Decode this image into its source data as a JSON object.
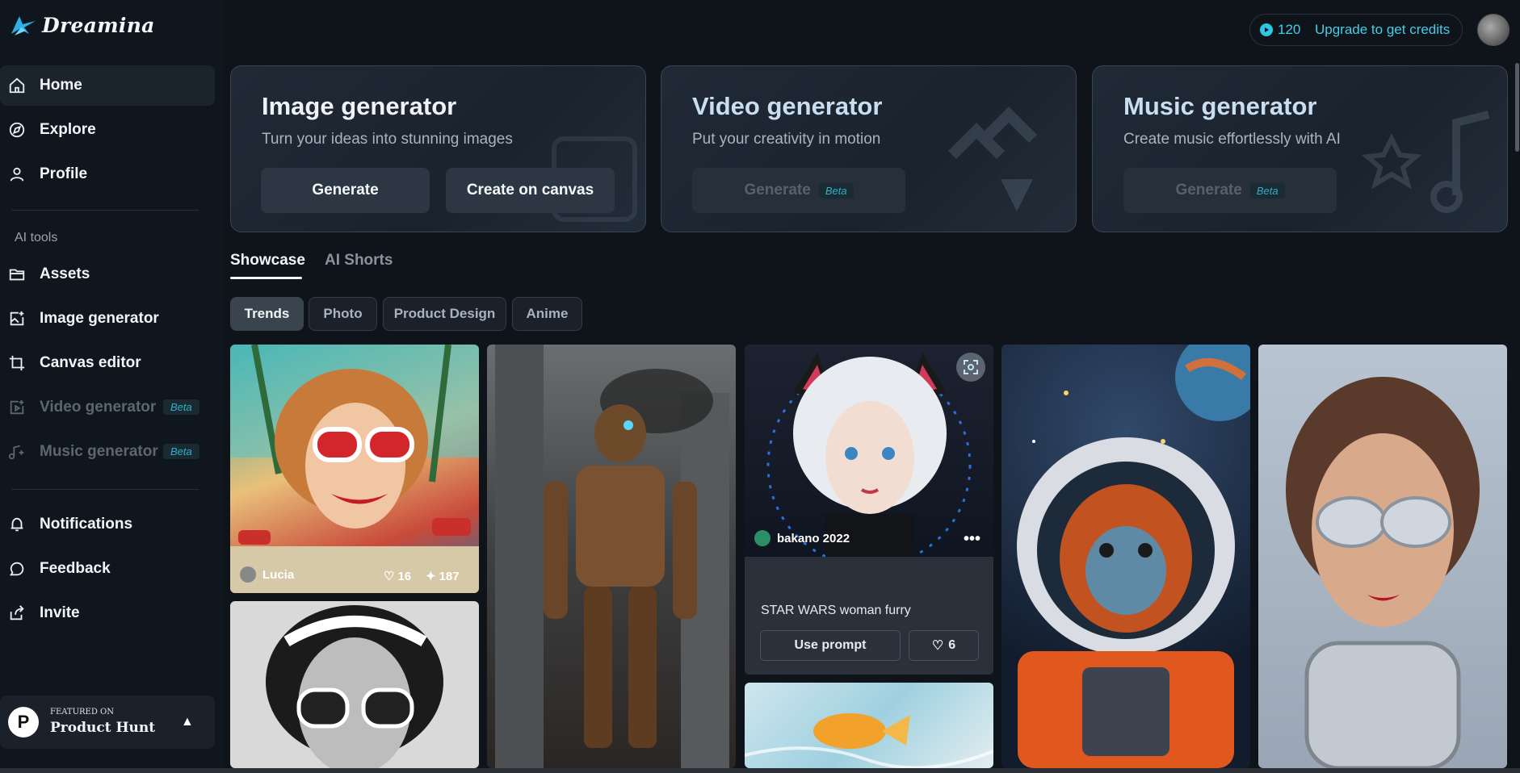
{
  "app": {
    "logo_text": "Dreamina"
  },
  "header": {
    "credits": "120",
    "upgrade_label": "Upgrade to get credits"
  },
  "sidebar": {
    "home": "Home",
    "explore": "Explore",
    "profile": "Profile",
    "section_ai_tools": "AI tools",
    "assets": "Assets",
    "image_generator": "Image generator",
    "canvas_editor": "Canvas editor",
    "video_generator": "Video generator",
    "music_generator": "Music generator",
    "beta": "Beta",
    "notifications": "Notifications",
    "feedback": "Feedback",
    "invite": "Invite",
    "product_hunt": {
      "small": "FEATURED ON",
      "big": "Product Hunt",
      "badge": "P"
    }
  },
  "cards": {
    "image": {
      "title": "Image generator",
      "subtitle": "Turn your ideas into stunning images",
      "generate": "Generate",
      "canvas": "Create on canvas"
    },
    "video": {
      "title": "Video generator",
      "subtitle": "Put your creativity in motion",
      "generate": "Generate",
      "beta": "Beta"
    },
    "music": {
      "title": "Music generator",
      "subtitle": "Create music effortlessly with AI",
      "generate": "Generate",
      "beta": "Beta"
    }
  },
  "tabs": {
    "showcase": "Showcase",
    "ai_shorts": "AI Shorts"
  },
  "filters": [
    "Trends",
    "Photo",
    "Product Design",
    "Anime"
  ],
  "gallery": {
    "tile1": {
      "author": "Lucia",
      "likes": "16",
      "remixes": "187"
    },
    "tile_featured": {
      "author": "bakano 2022",
      "prompt": "STAR WARS woman furry",
      "use_prompt": "Use prompt",
      "likes": "6"
    }
  },
  "icons": {
    "home": "home-icon",
    "explore": "compass-icon",
    "profile": "user-icon",
    "assets": "folder-icon",
    "image": "image-plus-icon",
    "canvas": "crop-icon",
    "video": "video-plus-icon",
    "music": "music-plus-icon",
    "notifications": "bell-icon",
    "feedback": "chat-icon",
    "invite": "share-icon"
  },
  "colors": {
    "accent": "#43cde8",
    "background": "#0f141b"
  }
}
